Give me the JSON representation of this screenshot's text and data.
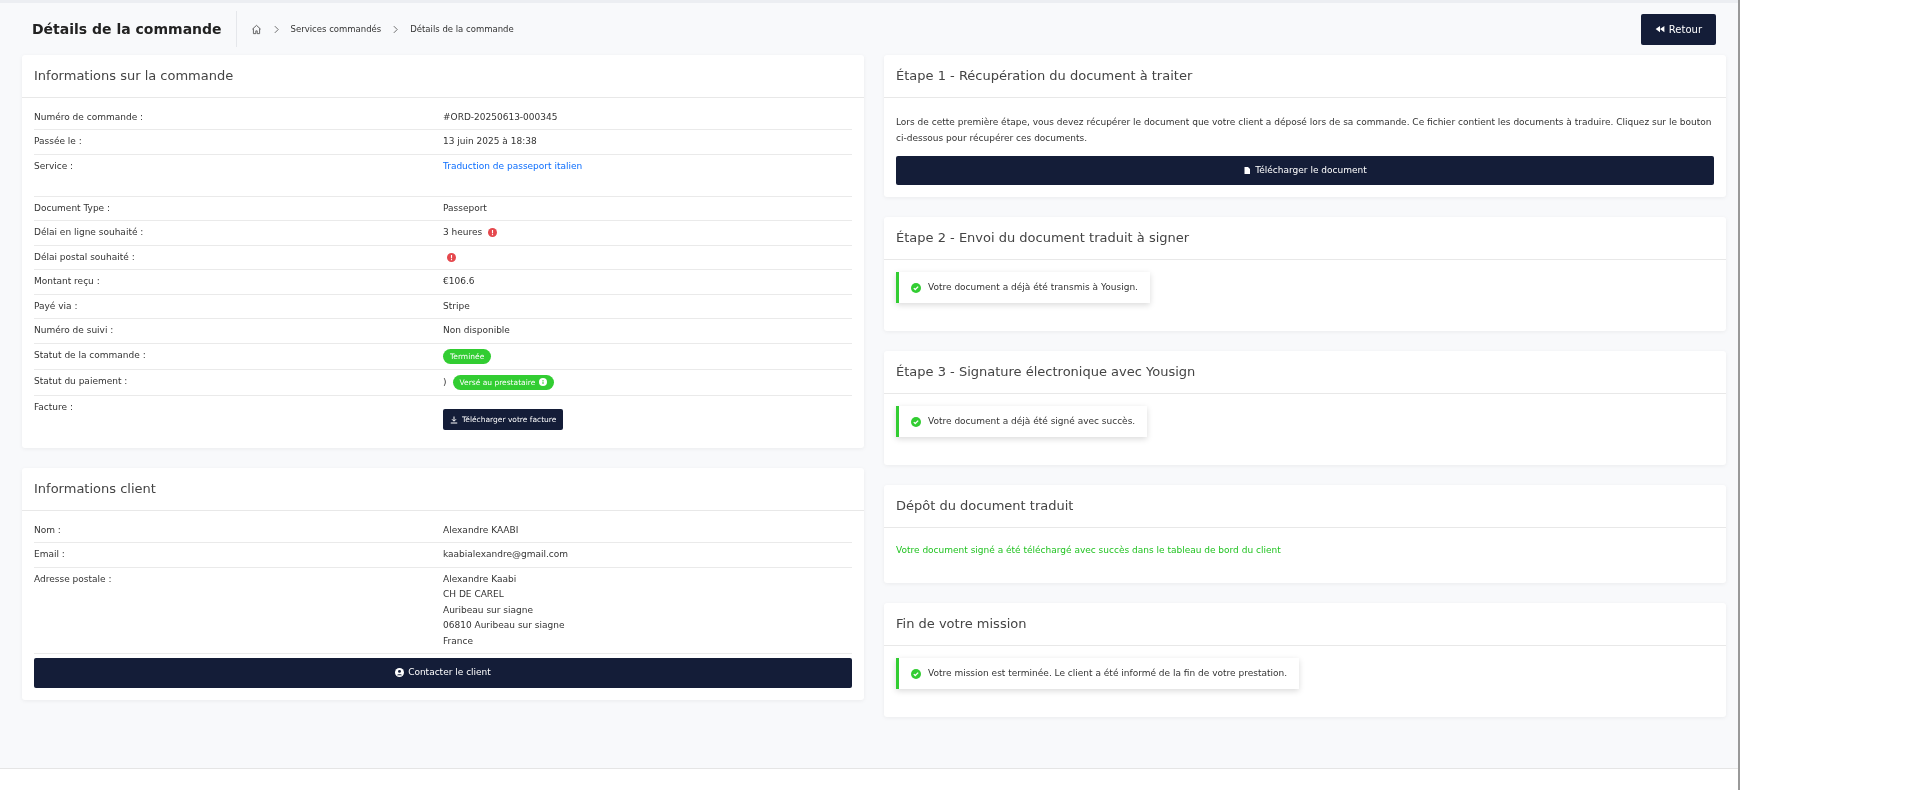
{
  "header": {
    "title": "Détails de la commande",
    "breadcrumb": [
      "Services commandés",
      "Détails de la commande"
    ],
    "back_button": "Retour"
  },
  "order_card": {
    "title": "Informations sur la commande",
    "rows": [
      {
        "label": "Numéro de commande :",
        "kind": "text",
        "value": "#ORD-20250613-000345"
      },
      {
        "label": "Passée le :",
        "kind": "text",
        "value": "13 juin 2025 à 18:38"
      },
      {
        "label": "Service :",
        "kind": "link",
        "value": "Traduction de passeport italien"
      },
      {
        "label": "Document Type :",
        "kind": "text",
        "value": "Passeport"
      },
      {
        "label": "Délai en ligne souhaité :",
        "kind": "alert",
        "value": "3 heures"
      },
      {
        "label": "Délai postal souhaité :",
        "kind": "alert"
      },
      {
        "label": "Montant reçu :",
        "kind": "text",
        "value": "€106.6"
      },
      {
        "label": "Payé via :",
        "kind": "text",
        "value": "Stripe"
      },
      {
        "label": "Numéro de suivi :",
        "kind": "text",
        "value": "Non disponible"
      },
      {
        "label": "Statut de la commande :",
        "kind": "badge",
        "value": "Terminée",
        "color": "#32cd32",
        "info": false
      },
      {
        "label": "Statut du paiement :",
        "kind": "badge",
        "prefix": ")",
        "value": "Versé au prestataire",
        "color": "#32cd32",
        "info": true
      },
      {
        "label": "Facture :",
        "kind": "button",
        "value": "Télécharger votre facture"
      }
    ]
  },
  "client_card": {
    "title": "Informations client",
    "rows": [
      {
        "label": "Nom :",
        "lines": [
          "Alexandre KAABI"
        ]
      },
      {
        "label": "Email :",
        "lines": [
          "kaabialexandre@gmail.com"
        ]
      },
      {
        "label": "Adresse postale :",
        "lines": [
          "Alexandre Kaabi",
          "CH DE CAREL",
          "Auribeau sur siagne",
          "06810 Auribeau sur siagne",
          "France"
        ]
      }
    ],
    "button": "Contacter le client"
  },
  "steps": [
    {
      "kind": "download",
      "title": "Étape 1 - Récupération du document à traiter",
      "text": "Lors de cette première étape, vous devez récupérer le document que votre client a déposé lors de sa commande. Ce fichier contient les documents à traduire. Cliquez sur le bouton ci-dessous pour récupérer ces documents.",
      "button": "Télécharger le document"
    },
    {
      "kind": "alert",
      "title": "Étape 2 - Envoi du document traduit à signer",
      "text": "Votre document a déjà été transmis à Yousign."
    },
    {
      "kind": "alert",
      "title": "Étape 3 - Signature électronique avec Yousign",
      "text": "Votre document a déjà été signé avec succès."
    },
    {
      "kind": "success_text",
      "title": "Dépôt du document traduit",
      "text": "Votre document signé a été téléchargé avec succès dans le tableau de bord du client"
    },
    {
      "kind": "alert",
      "title": "Fin de votre mission",
      "text": "Votre mission est terminée. Le client a été informé de la fin de votre prestation."
    }
  ]
}
